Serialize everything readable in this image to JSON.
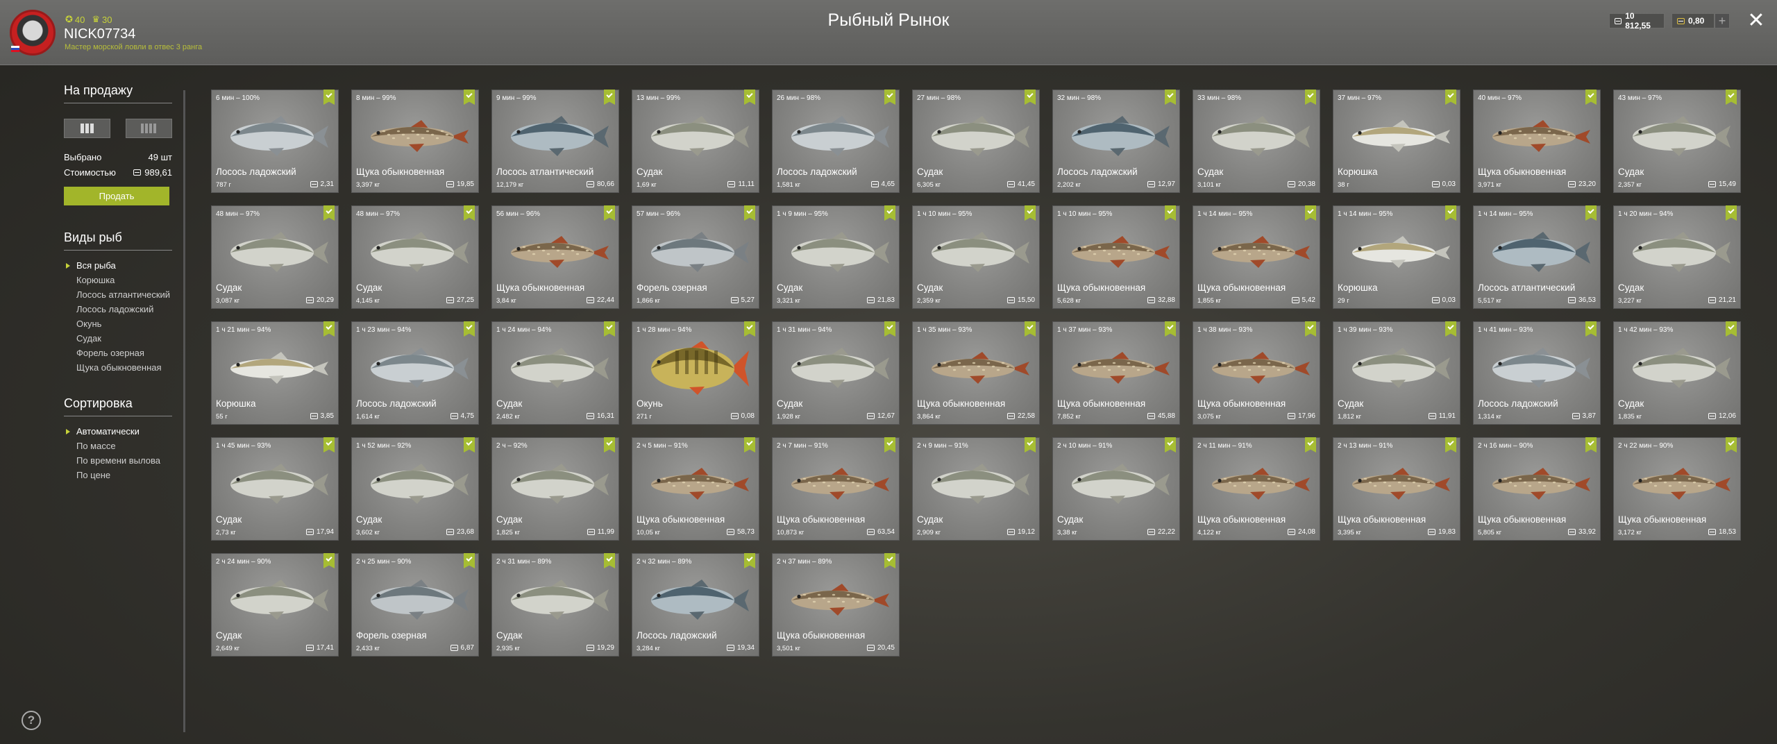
{
  "header": {
    "title": "Рыбный Рынок",
    "stat_level": "40",
    "stat_rank": "30",
    "username": "NICK07734",
    "rank_text": "Мастер морской ловли в отвес 3 ранга",
    "silver": "10 812,55",
    "gold": "0,80",
    "plus_label": "+",
    "close_label": "✕"
  },
  "sidebar": {
    "for_sale_title": "На продажу",
    "selected_label": "Выбрано",
    "selected_value": "49 шт",
    "cost_label": "Стоимостью",
    "cost_value": "989,61",
    "sell_button": "Продать",
    "species_title": "Виды рыб",
    "species": [
      "Вся рыба",
      "Корюшка",
      "Лосось атлантический",
      "Лосось ладожский",
      "Окунь",
      "Судак",
      "Форель озерная",
      "Щука обыкновенная"
    ],
    "sort_title": "Сортировка",
    "sort_options": [
      "Автоматически",
      "По массе",
      "По времени вылова",
      "По цене"
    ],
    "help_label": "?"
  },
  "colors": {
    "accent": "#a6bd33",
    "stat_text": "#c7d33a"
  },
  "fish": [
    {
      "time": "6 мин – 100%",
      "name": "Лосось ладожский",
      "weight": "787 г",
      "price": "2,31",
      "kind": "salmon"
    },
    {
      "time": "8 мин – 99%",
      "name": "Щука обыкновенная",
      "weight": "3,397 кг",
      "price": "19,85",
      "kind": "pike"
    },
    {
      "time": "9 мин – 99%",
      "name": "Лосось атлантический",
      "weight": "12,179 кг",
      "price": "80,66",
      "kind": "atlantic"
    },
    {
      "time": "13 мин – 99%",
      "name": "Судак",
      "weight": "1,69 кг",
      "price": "11,11",
      "kind": "zander"
    },
    {
      "time": "26 мин – 98%",
      "name": "Лосось ладожский",
      "weight": "1,581 кг",
      "price": "4,65",
      "kind": "salmon"
    },
    {
      "time": "27 мин – 98%",
      "name": "Судак",
      "weight": "6,305 кг",
      "price": "41,45",
      "kind": "zander"
    },
    {
      "time": "32 мин – 98%",
      "name": "Лосось ладожский",
      "weight": "2,202 кг",
      "price": "12,97",
      "kind": "atlantic"
    },
    {
      "time": "33 мин – 98%",
      "name": "Судак",
      "weight": "3,101 кг",
      "price": "20,38",
      "kind": "zander"
    },
    {
      "time": "37 мин – 97%",
      "name": "Корюшка",
      "weight": "38 г",
      "price": "0,03",
      "kind": "smelt"
    },
    {
      "time": "40 мин – 97%",
      "name": "Щука обыкновенная",
      "weight": "3,971 кг",
      "price": "23,20",
      "kind": "pike"
    },
    {
      "time": "43 мин – 97%",
      "name": "Судак",
      "weight": "2,357 кг",
      "price": "15,49",
      "kind": "zander"
    },
    {
      "time": "48 мин – 97%",
      "name": "Судак",
      "weight": "3,087 кг",
      "price": "20,29",
      "kind": "zander"
    },
    {
      "time": "48 мин – 97%",
      "name": "Судак",
      "weight": "4,145 кг",
      "price": "27,25",
      "kind": "zander"
    },
    {
      "time": "56 мин – 96%",
      "name": "Щука обыкновенная",
      "weight": "3,84 кг",
      "price": "22,44",
      "kind": "pike"
    },
    {
      "time": "57 мин – 96%",
      "name": "Форель озерная",
      "weight": "1,866 кг",
      "price": "5,27",
      "kind": "trout"
    },
    {
      "time": "1 ч 9 мин – 95%",
      "name": "Судак",
      "weight": "3,321 кг",
      "price": "21,83",
      "kind": "zander"
    },
    {
      "time": "1 ч 10 мин – 95%",
      "name": "Судак",
      "weight": "2,359 кг",
      "price": "15,50",
      "kind": "zander"
    },
    {
      "time": "1 ч 10 мин – 95%",
      "name": "Щука обыкновенная",
      "weight": "5,628 кг",
      "price": "32,88",
      "kind": "pike"
    },
    {
      "time": "1 ч 14 мин – 95%",
      "name": "Щука обыкновенная",
      "weight": "1,855 кг",
      "price": "5,42",
      "kind": "pike"
    },
    {
      "time": "1 ч 14 мин – 95%",
      "name": "Корюшка",
      "weight": "29 г",
      "price": "0,03",
      "kind": "smelt"
    },
    {
      "time": "1 ч 14 мин – 95%",
      "name": "Лосось атлантический",
      "weight": "5,517 кг",
      "price": "36,53",
      "kind": "atlantic"
    },
    {
      "time": "1 ч 20 мин – 94%",
      "name": "Судак",
      "weight": "3,227 кг",
      "price": "21,21",
      "kind": "zander"
    },
    {
      "time": "1 ч 21 мин – 94%",
      "name": "Корюшка",
      "weight": "55 г",
      "price": "3,85",
      "kind": "smelt"
    },
    {
      "time": "1 ч 23 мин – 94%",
      "name": "Лосось ладожский",
      "weight": "1,614 кг",
      "price": "4,75",
      "kind": "salmon"
    },
    {
      "time": "1 ч 24 мин – 94%",
      "name": "Судак",
      "weight": "2,482 кг",
      "price": "16,31",
      "kind": "zander"
    },
    {
      "time": "1 ч 28 мин – 94%",
      "name": "Окунь",
      "weight": "271 г",
      "price": "0,08",
      "kind": "perch"
    },
    {
      "time": "1 ч 31 мин – 94%",
      "name": "Судак",
      "weight": "1,928 кг",
      "price": "12,67",
      "kind": "zander"
    },
    {
      "time": "1 ч 35 мин – 93%",
      "name": "Щука обыкновенная",
      "weight": "3,864 кг",
      "price": "22,58",
      "kind": "pike"
    },
    {
      "time": "1 ч 37 мин – 93%",
      "name": "Щука обыкновенная",
      "weight": "7,852 кг",
      "price": "45,88",
      "kind": "pike"
    },
    {
      "time": "1 ч 38 мин – 93%",
      "name": "Щука обыкновенная",
      "weight": "3,075 кг",
      "price": "17,96",
      "kind": "pike"
    },
    {
      "time": "1 ч 39 мин – 93%",
      "name": "Судак",
      "weight": "1,812 кг",
      "price": "11,91",
      "kind": "zander"
    },
    {
      "time": "1 ч 41 мин – 93%",
      "name": "Лосось ладожский",
      "weight": "1,314 кг",
      "price": "3,87",
      "kind": "salmon"
    },
    {
      "time": "1 ч 42 мин – 93%",
      "name": "Судак",
      "weight": "1,835 кг",
      "price": "12,06",
      "kind": "zander"
    },
    {
      "time": "1 ч 45 мин – 93%",
      "name": "Судак",
      "weight": "2,73 кг",
      "price": "17,94",
      "kind": "zander"
    },
    {
      "time": "1 ч 52 мин – 92%",
      "name": "Судак",
      "weight": "3,602 кг",
      "price": "23,68",
      "kind": "zander"
    },
    {
      "time": "2 ч – 92%",
      "name": "Судак",
      "weight": "1,825 кг",
      "price": "11,99",
      "kind": "zander"
    },
    {
      "time": "2 ч 5 мин – 91%",
      "name": "Щука обыкновенная",
      "weight": "10,05 кг",
      "price": "58,73",
      "kind": "pike"
    },
    {
      "time": "2 ч 7 мин – 91%",
      "name": "Щука обыкновенная",
      "weight": "10,873 кг",
      "price": "63,54",
      "kind": "pike"
    },
    {
      "time": "2 ч 9 мин – 91%",
      "name": "Судак",
      "weight": "2,909 кг",
      "price": "19,12",
      "kind": "zander"
    },
    {
      "time": "2 ч 10 мин – 91%",
      "name": "Судак",
      "weight": "3,38 кг",
      "price": "22,22",
      "kind": "zander"
    },
    {
      "time": "2 ч 11 мин – 91%",
      "name": "Щука обыкновенная",
      "weight": "4,122 кг",
      "price": "24,08",
      "kind": "pike"
    },
    {
      "time": "2 ч 13 мин – 91%",
      "name": "Щука обыкновенная",
      "weight": "3,395 кг",
      "price": "19,83",
      "kind": "pike"
    },
    {
      "time": "2 ч 16 мин – 90%",
      "name": "Щука обыкновенная",
      "weight": "5,805 кг",
      "price": "33,92",
      "kind": "pike"
    },
    {
      "time": "2 ч 22 мин – 90%",
      "name": "Щука обыкновенная",
      "weight": "3,172 кг",
      "price": "18,53",
      "kind": "pike"
    },
    {
      "time": "2 ч 24 мин – 90%",
      "name": "Судак",
      "weight": "2,649 кг",
      "price": "17,41",
      "kind": "zander"
    },
    {
      "time": "2 ч 25 мин – 90%",
      "name": "Форель озерная",
      "weight": "2,433 кг",
      "price": "6,87",
      "kind": "trout"
    },
    {
      "time": "2 ч 31 мин – 89%",
      "name": "Судак",
      "weight": "2,935 кг",
      "price": "19,29",
      "kind": "zander"
    },
    {
      "time": "2 ч 32 мин – 89%",
      "name": "Лосось ладожский",
      "weight": "3,284 кг",
      "price": "19,34",
      "kind": "atlantic"
    },
    {
      "time": "2 ч 37 мин – 89%",
      "name": "Щука обыкновенная",
      "weight": "3,501 кг",
      "price": "20,45",
      "kind": "pike"
    }
  ]
}
